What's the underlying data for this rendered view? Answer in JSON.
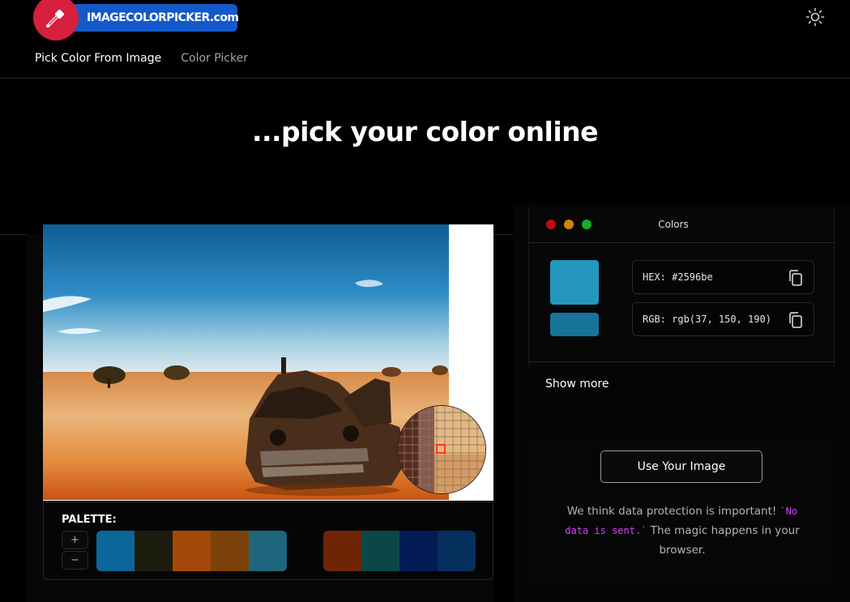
{
  "brand": {
    "name": "IMAGECOLORPICKER.com",
    "primary_color": "#1459c9",
    "logo_color": "#d61f3c"
  },
  "header": {
    "theme_icon": "sun-icon"
  },
  "nav": {
    "items": [
      {
        "label": "Pick Color From Image",
        "active": true
      },
      {
        "label": "Color Picker",
        "active": false
      }
    ]
  },
  "hero": {
    "title": "...pick your color online"
  },
  "picker": {
    "palette_title": "PALETTE:",
    "plus_label": "+",
    "minus_label": "−",
    "swatches_group1": [
      "#0b6699",
      "#1c1d0e",
      "#a4480a",
      "#7b4209",
      "#1f667d"
    ],
    "swatches_group2": [
      "#6d2506",
      "#0b4748",
      "#041b56",
      "#05305e"
    ]
  },
  "colors": {
    "title": "Colors",
    "selected_color": "#2596be",
    "secondary_color": "#17739a",
    "hex_text": "HEX: #2596be",
    "rgb_text": "RGB: rgb(37, 150, 190)",
    "copy_icon": "copy-icon",
    "show_more_label": "Show more",
    "window_dots": [
      "#c20d0d",
      "#d08510",
      "#14b023"
    ]
  },
  "upload": {
    "button_label": "Use Your Image",
    "privacy_before": "We think data protection is important! ",
    "privacy_code": "`No data is sent.`",
    "privacy_after": " The magic happens in your browser."
  }
}
